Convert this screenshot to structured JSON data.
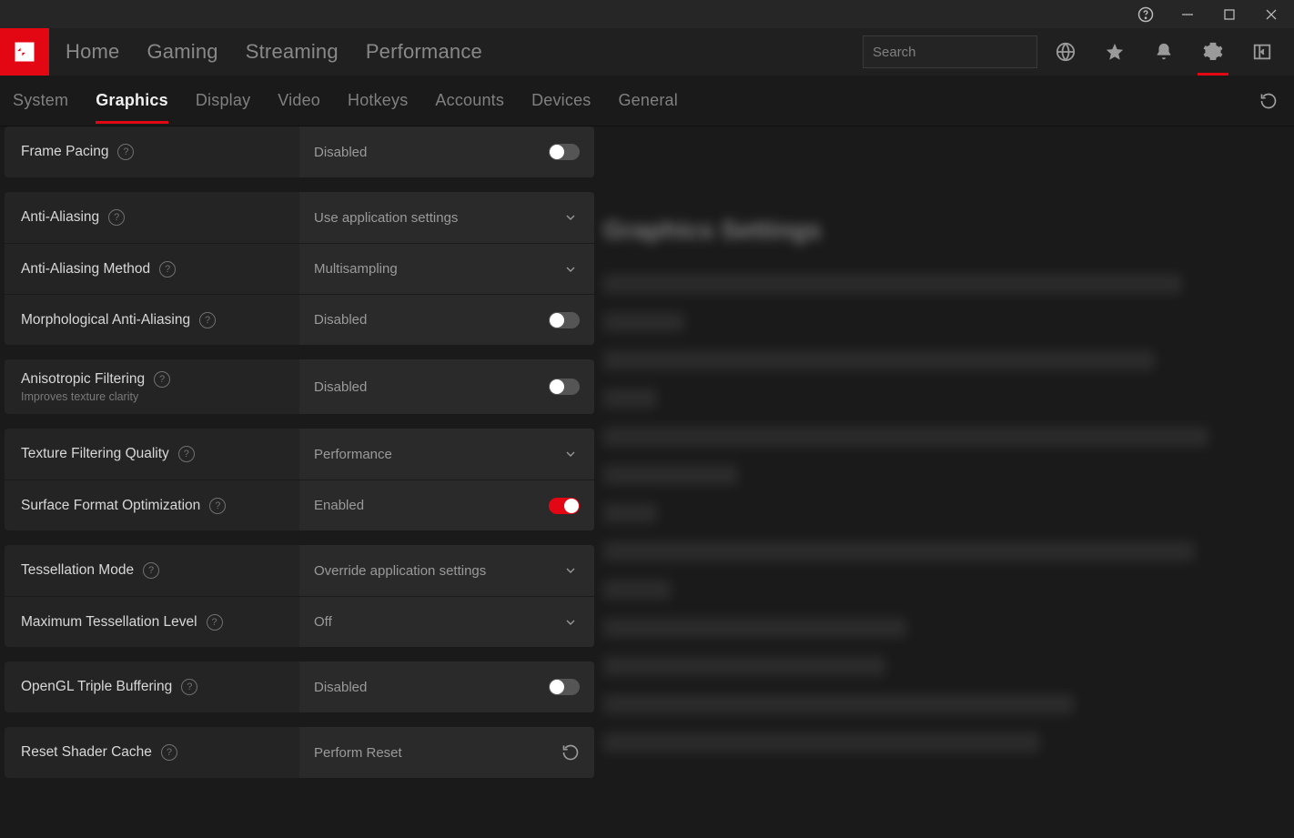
{
  "titlebar": {
    "help": "help-icon"
  },
  "mainnav": {
    "items": [
      "Home",
      "Gaming",
      "Streaming",
      "Performance"
    ]
  },
  "search": {
    "placeholder": "Search"
  },
  "subtabs": {
    "items": [
      "System",
      "Graphics",
      "Display",
      "Video",
      "Hotkeys",
      "Accounts",
      "Devices",
      "General"
    ],
    "active": 1
  },
  "settings": {
    "frame_pacing": {
      "label": "Frame Pacing",
      "value": "Disabled",
      "on": false
    },
    "anti_aliasing": {
      "label": "Anti-Aliasing",
      "value": "Use application settings"
    },
    "aa_method": {
      "label": "Anti-Aliasing Method",
      "value": "Multisampling"
    },
    "morph_aa": {
      "label": "Morphological Anti-Aliasing",
      "value": "Disabled",
      "on": false
    },
    "aniso": {
      "label": "Anisotropic Filtering",
      "sub": "Improves texture clarity",
      "value": "Disabled",
      "on": false
    },
    "tex_filter": {
      "label": "Texture Filtering Quality",
      "value": "Performance"
    },
    "surface_fmt": {
      "label": "Surface Format Optimization",
      "value": "Enabled",
      "on": true
    },
    "tess_mode": {
      "label": "Tessellation Mode",
      "value": "Override application settings"
    },
    "max_tess": {
      "label": "Maximum Tessellation Level",
      "value": "Off"
    },
    "ogl_triple": {
      "label": "OpenGL Triple Buffering",
      "value": "Disabled",
      "on": false
    },
    "reset_shader": {
      "label": "Reset Shader Cache",
      "value": "Perform Reset"
    }
  },
  "right_panel": {
    "heading": "Graphics Settings"
  }
}
